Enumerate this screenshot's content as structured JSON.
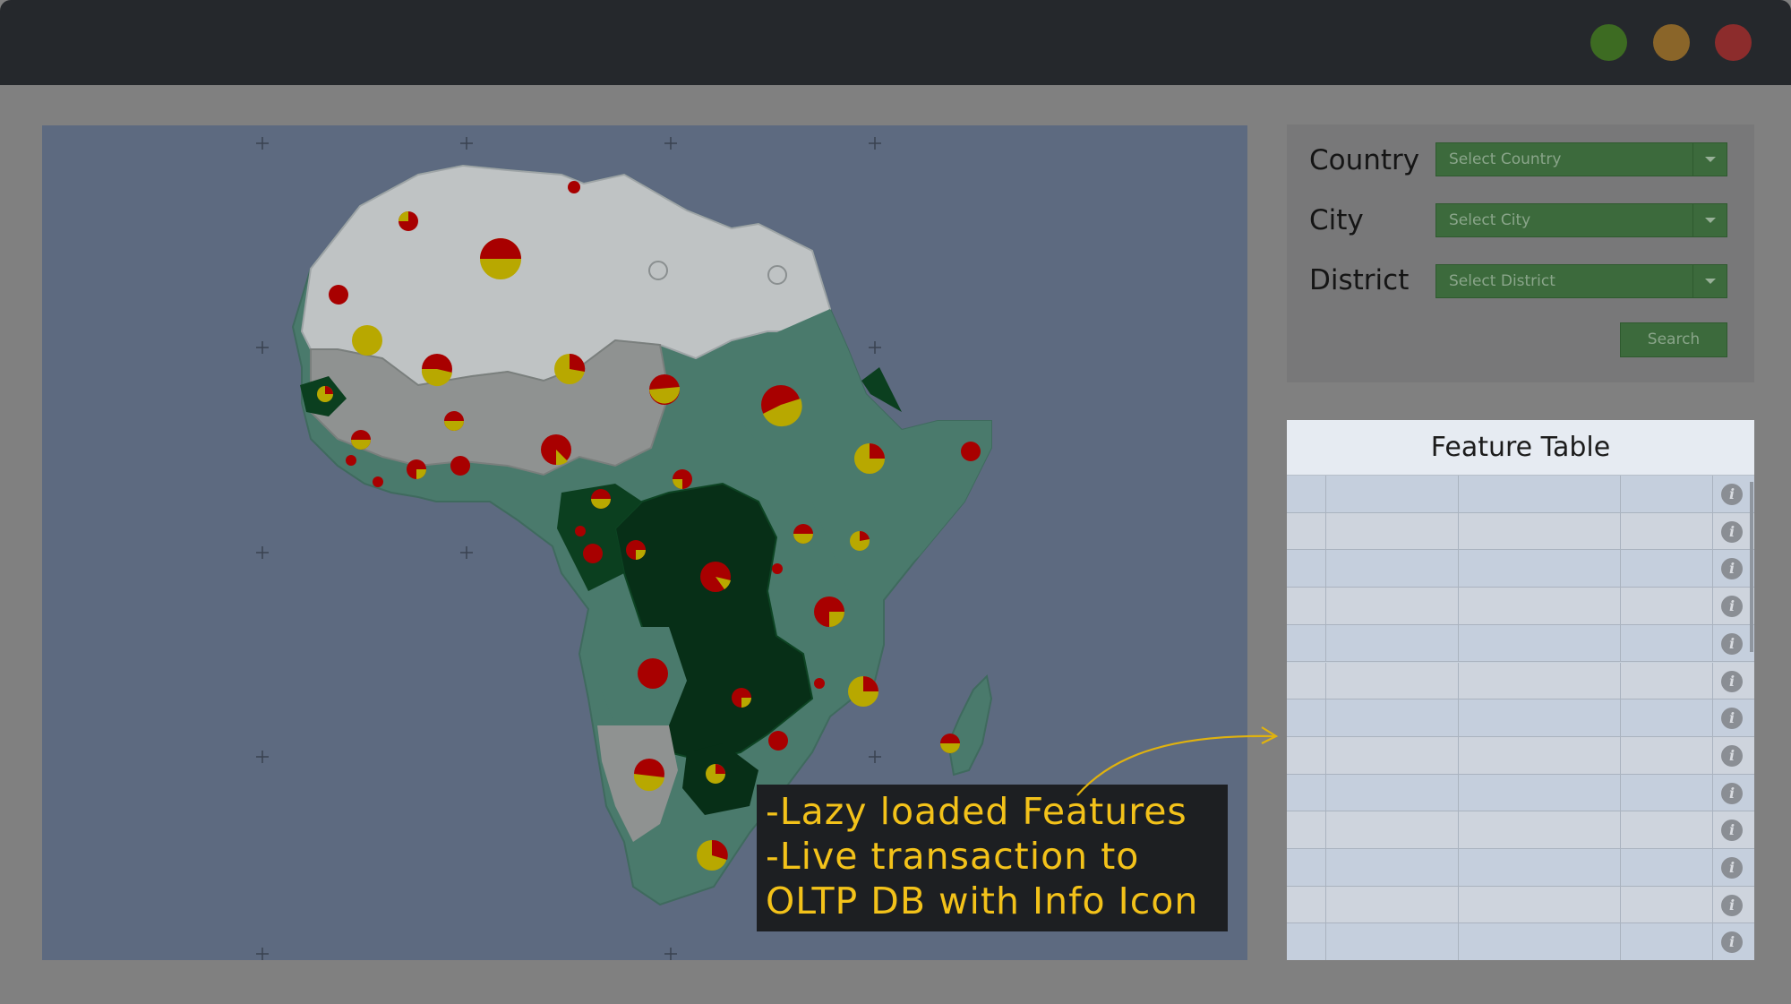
{
  "window": {
    "buttons": [
      "minimize",
      "maximize",
      "close"
    ]
  },
  "filters": {
    "country_label": "Country",
    "country_placeholder": "Select Country",
    "city_label": "City",
    "city_placeholder": "Select City",
    "district_label": "District",
    "district_placeholder": "Select District",
    "search_label": "Search"
  },
  "feature_table": {
    "title": "Feature Table",
    "info_glyph": "i",
    "row_count": 13
  },
  "annotation": {
    "line1": "-Lazy loaded Features",
    "line2": "-Live transaction to",
    "line3": "OLTP DB with Info Icon"
  },
  "colors": {
    "accent_green": "#3c6a3c",
    "annotation_text": "#f3c21a",
    "pie_red": "#a80000",
    "pie_yellow": "#b8a800"
  }
}
